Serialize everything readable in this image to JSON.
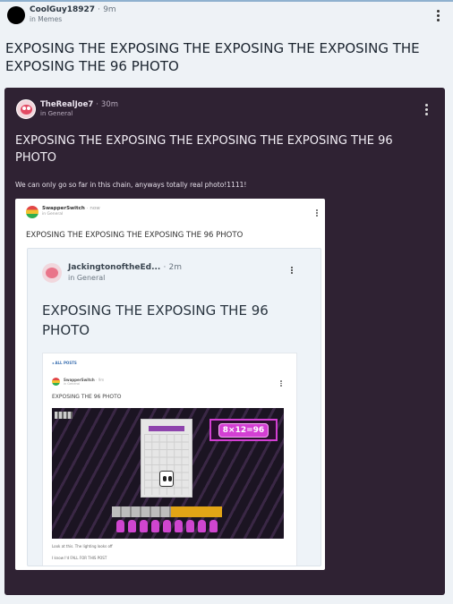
{
  "post": {
    "username": "CoolGuy18927",
    "separator": "·",
    "time": "9m",
    "community": "in Memes",
    "title": "EXPOSING THE EXPOSING THE EXPOSING THE EXPOSING THE EXPOSING THE 96 PHOTO"
  },
  "quoted": {
    "username": "TheRealJoe7",
    "separator": "·",
    "time": "30m",
    "community": "in General",
    "title": "EXPOSING THE EXPOSING THE EXPOSING THE EXPOSING THE 96 PHOTO",
    "body": "We can only go so far in this chain, anyways totally real photo!1111!"
  },
  "screenshot": {
    "username": "SwapperSwitch",
    "separator": "·",
    "time": "now",
    "community": "in General",
    "title": "EXPOSING THE EXPOSING THE EXPOSING THE 96 PHOTO"
  },
  "nested": {
    "username": "JackingtonoftheEd...",
    "separator": "·",
    "time": "2m",
    "community": "in General",
    "title": "EXPOSING THE EXPOSING THE 96 PHOTO"
  },
  "deepest": {
    "back_label": "◂ ALL POSTS",
    "username": "SwapperSwitch",
    "separator": "·",
    "time": "9m",
    "community": "in General",
    "title": "EXPOSING THE 96 PHOTO",
    "equation": "8×12=96",
    "caption": "Look at this. The lighting looks off",
    "caption2": "I know I'd FALL FOR THIS POST"
  },
  "colors": {
    "dark_card": "#2f2233",
    "page_bg": "#eef2f6",
    "accent_magenta": "#d33fd3"
  },
  "icons": [
    "kebab-menu-icon",
    "avatar"
  ]
}
